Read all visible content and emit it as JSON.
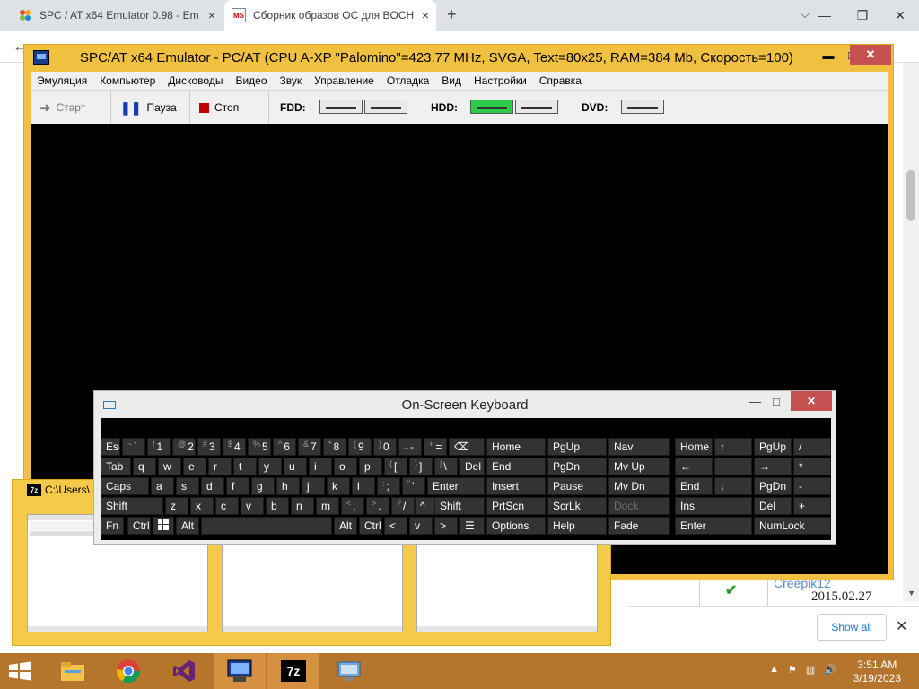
{
  "browser": {
    "tabs": [
      {
        "title": "SPC / AT x64 Emulator 0.98 - Em",
        "active": false
      },
      {
        "title": "Сборник образов ОС для BOCH",
        "active": true
      }
    ],
    "tab2_favicon": "MS"
  },
  "emulator": {
    "title": "SPC/AT x64 Emulator - PC/AT (CPU A-XP \"Palomino\"=423.77 MHz, SVGA, Text=80x25, RAM=384 Mb, Скорость=100)",
    "menu": [
      "Эмуляция",
      "Компьютер",
      "Дисководы",
      "Видео",
      "Звук",
      "Управление",
      "Отладка",
      "Вид",
      "Настройки",
      "Справка"
    ],
    "toolbar": {
      "start": "Старт",
      "pause": "Пауза",
      "stop": "Стоп",
      "fdd": "FDD:",
      "hdd": "HDD:",
      "dvd": "DVD:"
    },
    "accent": "#f0c040"
  },
  "osk": {
    "title": "On-Screen Keyboard",
    "keys": {
      "esc": "Esc",
      "tilde_shift": "~",
      "tilde": "`",
      "k1_shift": "!",
      "k1": "1",
      "k2_shift": "@",
      "k2": "2",
      "k3_shift": "#",
      "k3": "3",
      "k4_shift": "$",
      "k4": "4",
      "k5_shift": "%",
      "k5": "5",
      "k6_shift": "^",
      "k6": "6",
      "k7_shift": "&",
      "k7": "7",
      "k8_shift": "*",
      "k8": "8",
      "k9_shift": "(",
      "k9": "9",
      "k0_shift": ")",
      "k0": "0",
      "minus_shift": "_",
      "minus": "-",
      "equals_shift": "+",
      "equals": "=",
      "backspace": "⌫",
      "tab": "Tab",
      "q": "q",
      "w": "w",
      "e": "e",
      "r": "r",
      "t": "t",
      "y": "y",
      "u": "u",
      "i": "i",
      "o": "o",
      "p": "p",
      "lbracket_shift": "{",
      "lbracket": "[",
      "rbracket_shift": "}",
      "rbracket": "]",
      "backslash_shift": "|",
      "backslash": "\\",
      "del": "Del",
      "caps": "Caps",
      "a": "a",
      "s": "s",
      "d": "d",
      "f": "f",
      "g": "g",
      "h": "h",
      "j": "j",
      "k": "k",
      "l": "l",
      "semicolon_shift": ":",
      "semicolon": ";",
      "quote_shift": "\"",
      "quote": "'",
      "enter": "Enter",
      "shift": "Shift",
      "z": "z",
      "x": "x",
      "c": "c",
      "v": "v",
      "b": "b",
      "n": "n",
      "m": "m",
      "comma_shift": "<",
      "comma": ",",
      "period_shift": ">",
      "period": ".",
      "slash_shift": "?",
      "slash": "/",
      "up": "^",
      "shift_right": "Shift",
      "fn": "Fn",
      "ctrl": "Ctrl",
      "alt": "Alt",
      "alt_right": "Alt",
      "ctrl_right": "Ctrl",
      "left": "<",
      "down": "v",
      "right": ">",
      "home": "Home",
      "pgup": "PgUp",
      "nav": "Nav",
      "end": "End",
      "pgdn": "PgDn",
      "mvup": "Mv Up",
      "insert": "Insert",
      "pause": "Pause",
      "mvdn": "Mv Dn",
      "prtscn": "PrtScn",
      "scrlk": "ScrLk",
      "dock": "Dock",
      "options": "Options",
      "help": "Help",
      "fade": "Fade",
      "np_home": "Home",
      "np_up": "↑",
      "np_pgup": "PgUp",
      "np_div": "/",
      "np_left": "←",
      "np_right": "→",
      "np_mul": "*",
      "np_end": "End",
      "np_down": "↓",
      "np_pgdn": "PgDn",
      "np_sub": "-",
      "np_ins": "Ins",
      "np_del": "Del",
      "np_add": "+",
      "np_enter": "Enter",
      "numlock": "NumLock"
    }
  },
  "sevenzip": {
    "title": "C:\\Users\\",
    "icon_label": "7z"
  },
  "page": {
    "user": "Creepik12",
    "date": "2015.02.27",
    "show_all": "Show all"
  },
  "taskbar": {
    "time": "3:51 AM",
    "date": "3/19/2023",
    "sevenzip_label": "7z"
  }
}
